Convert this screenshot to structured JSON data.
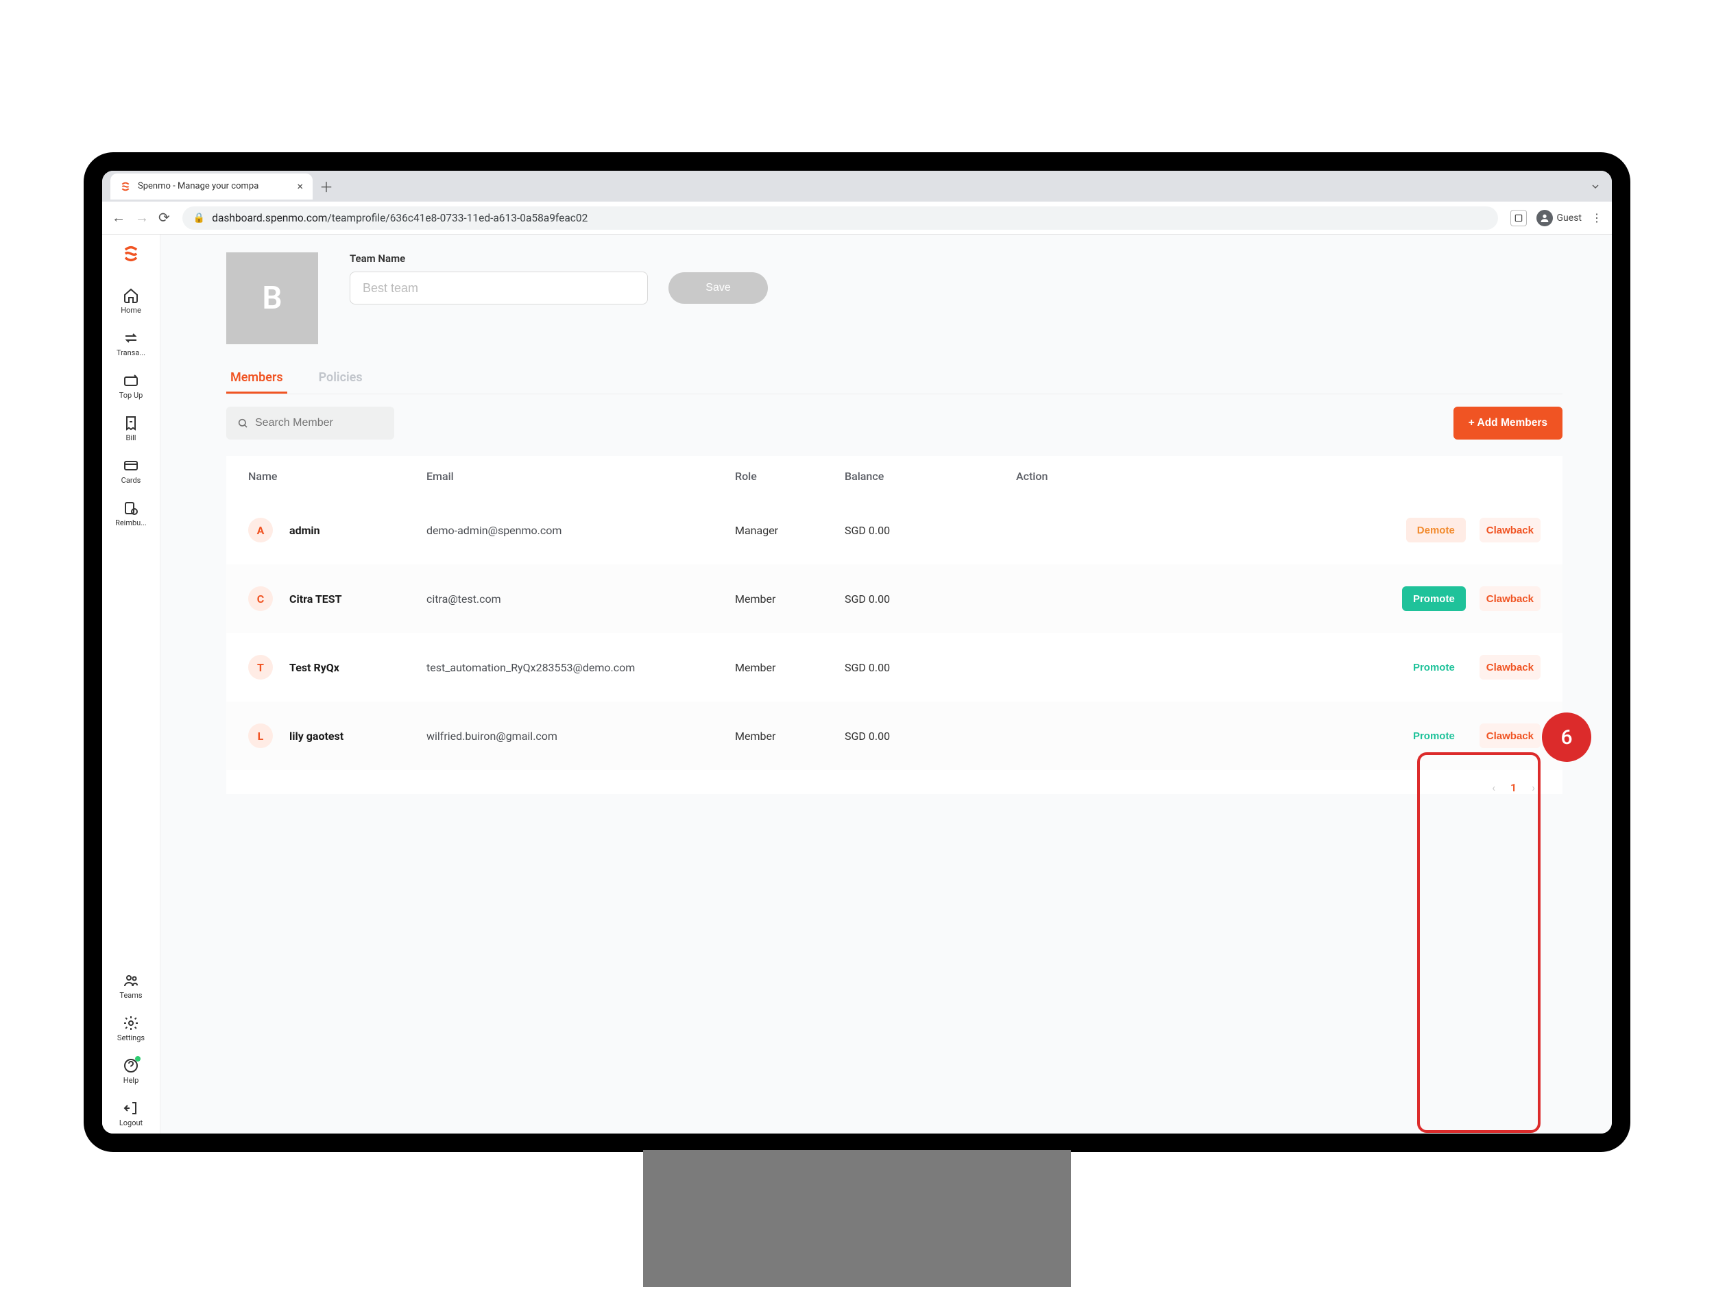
{
  "browser": {
    "tab_title": "Spenmo - Manage your compa",
    "guest_label": "Guest",
    "url_domain": "dashboard.spenmo.com",
    "url_path": "/teamprofile/636c41e8-0733-11ed-a613-0a58a9feac02"
  },
  "sidebar": {
    "items": [
      {
        "icon": "home",
        "label": "Home"
      },
      {
        "icon": "swap",
        "label": "Transa..."
      },
      {
        "icon": "topup",
        "label": "Top Up"
      },
      {
        "icon": "bill",
        "label": "Bill"
      },
      {
        "icon": "card",
        "label": "Cards"
      },
      {
        "icon": "reimb",
        "label": "Reimbu..."
      }
    ],
    "footer_items": [
      {
        "icon": "teams",
        "label": "Teams"
      },
      {
        "icon": "settings",
        "label": "Settings"
      },
      {
        "icon": "help",
        "label": "Help"
      },
      {
        "icon": "logout",
        "label": "Logout"
      }
    ]
  },
  "team": {
    "avatar_letter": "B",
    "name_label": "Team Name",
    "name_value": "Best team",
    "save_label": "Save"
  },
  "tabs": {
    "members": "Members",
    "policies": "Policies"
  },
  "filters": {
    "search_placeholder": "Search Member",
    "add_label": "+ Add Members"
  },
  "table": {
    "columns": {
      "name": "Name",
      "email": "Email",
      "role": "Role",
      "balance": "Balance",
      "action": "Action"
    },
    "rows": [
      {
        "letter": "A",
        "name": "admin",
        "email": "demo-admin@spenmo.com",
        "role": "Manager",
        "balance": "SGD 0.00",
        "primary": "Demote",
        "primaryStyle": "demote",
        "secondary": "Clawback"
      },
      {
        "letter": "C",
        "name": "Citra TEST",
        "email": "citra@test.com",
        "role": "Member",
        "balance": "SGD 0.00",
        "primary": "Promote",
        "primaryStyle": "promote",
        "secondary": "Clawback"
      },
      {
        "letter": "T",
        "name": "Test RyQx",
        "email": "test_automation_RyQx283553@demo.com",
        "role": "Member",
        "balance": "SGD 0.00",
        "primary": "Promote",
        "primaryStyle": "promote-text",
        "secondary": "Clawback"
      },
      {
        "letter": "L",
        "name": "lily gaotest",
        "email": "wilfried.buiron@gmail.com",
        "role": "Member",
        "balance": "SGD 0.00",
        "primary": "Promote",
        "primaryStyle": "promote-text",
        "secondary": "Clawback"
      }
    ]
  },
  "pagination": {
    "current": "1"
  },
  "annotation": {
    "badge": "6"
  }
}
